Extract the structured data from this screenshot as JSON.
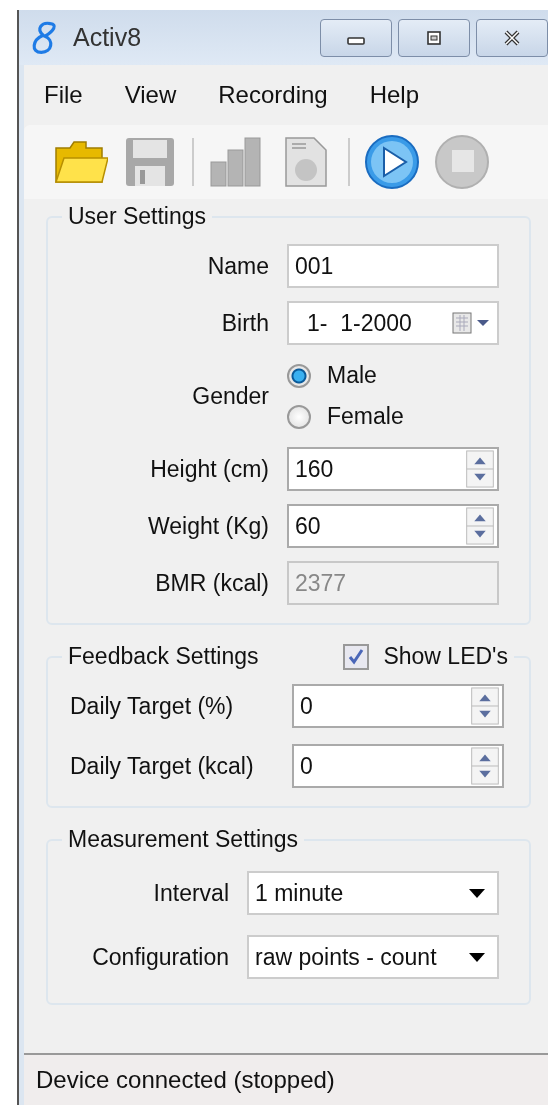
{
  "window": {
    "title": "Activ8"
  },
  "menu": [
    "File",
    "View",
    "Recording",
    "Help"
  ],
  "toolbar": [
    {
      "kind": "open",
      "disabled": false
    },
    {
      "kind": "save",
      "disabled": true
    },
    {
      "kind": "separator"
    },
    {
      "kind": "chart",
      "disabled": true
    },
    {
      "kind": "document",
      "disabled": true
    },
    {
      "kind": "separator"
    },
    {
      "kind": "play",
      "disabled": false
    },
    {
      "kind": "stop",
      "disabled": true
    }
  ],
  "user_settings": {
    "title": "User Settings",
    "rows": [
      {
        "kind": "text",
        "label": "Name",
        "value": "001"
      },
      {
        "kind": "date",
        "label": "Birth",
        "value": "1-  1-2000"
      },
      {
        "kind": "radio",
        "label": "Gender",
        "options": [
          {
            "label": "Male",
            "selected": true
          },
          {
            "label": "Female",
            "selected": false
          }
        ]
      },
      {
        "kind": "spin",
        "label": "Height (cm)",
        "value": "160"
      },
      {
        "kind": "spin",
        "label": "Weight (Kg)",
        "value": "60"
      },
      {
        "kind": "text",
        "label": "BMR (kcal)",
        "value": "2377",
        "disabled": true
      }
    ]
  },
  "feedback_settings": {
    "title": "Feedback Settings",
    "show_leds": {
      "label": "Show LED's",
      "checked": true
    },
    "rows": [
      {
        "kind": "spin",
        "label": "Daily Target (%)",
        "value": "0"
      },
      {
        "kind": "spin",
        "label": "Daily Target (kcal)",
        "value": "0"
      }
    ]
  },
  "measurement_settings": {
    "title": "Measurement Settings",
    "rows": [
      {
        "kind": "select",
        "label": "Interval",
        "value": "1 minute"
      },
      {
        "kind": "select",
        "label": "Configuration",
        "value": "raw points - count"
      }
    ]
  },
  "status_bar": {
    "text": "Device connected (stopped)"
  }
}
